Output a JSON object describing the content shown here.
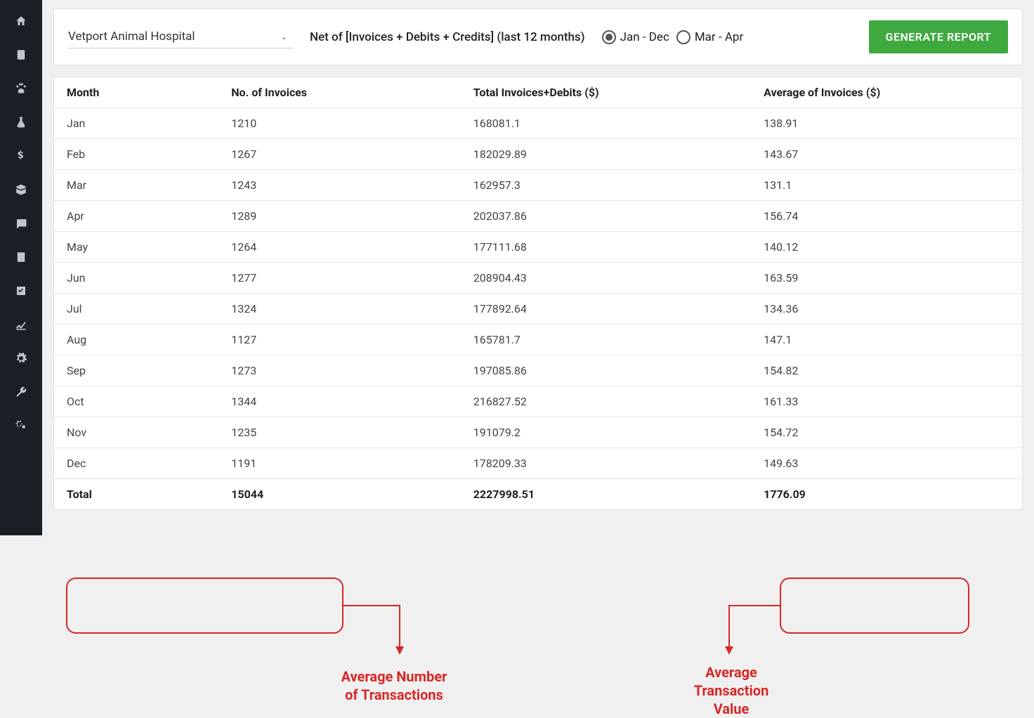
{
  "sidebar": {
    "icons": [
      "home",
      "clipboard",
      "paw",
      "flask",
      "dollar",
      "box",
      "chat",
      "form",
      "checkbox",
      "chart-line",
      "gear",
      "wrench",
      "cogs"
    ]
  },
  "header": {
    "hospital": "Vetport Animal Hospital",
    "filter_label": "Net of [Invoices + Debits + Credits] (last 12 months)",
    "range_options": [
      {
        "label": "Jan - Dec",
        "checked": true
      },
      {
        "label": "Mar  - Apr",
        "checked": false
      }
    ],
    "generate_label": "GENERATE REPORT"
  },
  "table": {
    "columns": [
      "Month",
      "No. of Invoices",
      "Total Invoices+Debits ($)",
      "Average of Invoices ($)"
    ],
    "rows": [
      {
        "month": "Jan",
        "invoices": "1210",
        "total": "168081.1",
        "avg": "138.91"
      },
      {
        "month": "Feb",
        "invoices": "1267",
        "total": "182029.89",
        "avg": "143.67"
      },
      {
        "month": "Mar",
        "invoices": "1243",
        "total": "162957.3",
        "avg": "131.1"
      },
      {
        "month": "Apr",
        "invoices": "1289",
        "total": "202037.86",
        "avg": "156.74"
      },
      {
        "month": "May",
        "invoices": "1264",
        "total": "177111.68",
        "avg": "140.12"
      },
      {
        "month": "Jun",
        "invoices": "1277",
        "total": "208904.43",
        "avg": "163.59"
      },
      {
        "month": "Jul",
        "invoices": "1324",
        "total": "177892.64",
        "avg": "134.36"
      },
      {
        "month": "Aug",
        "invoices": "1127",
        "total": "165781.7",
        "avg": "147.1"
      },
      {
        "month": "Sep",
        "invoices": "1273",
        "total": "197085.86",
        "avg": "154.82"
      },
      {
        "month": "Oct",
        "invoices": "1344",
        "total": "216827.52",
        "avg": "161.33"
      },
      {
        "month": "Nov",
        "invoices": "1235",
        "total": "191079.2",
        "avg": "154.72"
      },
      {
        "month": "Dec",
        "invoices": "1191",
        "total": "178209.33",
        "avg": "149.63"
      }
    ],
    "total": {
      "month": "Total",
      "invoices": "15044",
      "total": "2227998.51",
      "avg": "1776.09"
    }
  },
  "annotations": {
    "left_label": "Average Number\nof Transactions",
    "right_label": "Average\nTransaction\nValue"
  }
}
